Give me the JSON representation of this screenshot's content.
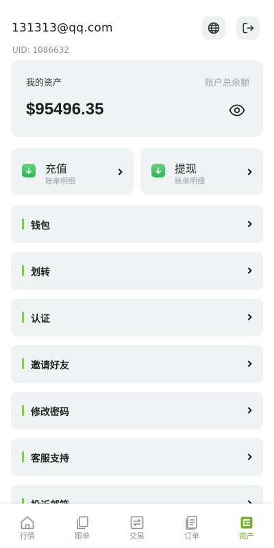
{
  "user": {
    "email": "131313@qq.com",
    "uid": "UID: 1086632"
  },
  "header": {
    "globe_icon": "globe-icon",
    "logout_icon": "logout-icon"
  },
  "asset": {
    "title": "我的资产",
    "subtitle": "账户总余额",
    "amount": "$95496.35",
    "visibility_icon": "eye-icon"
  },
  "quick_actions": [
    {
      "title": "充值",
      "sub": "账单明细",
      "icon": "download-arrow-icon"
    },
    {
      "title": "提现",
      "sub": "账单明细",
      "icon": "download-arrow-icon"
    }
  ],
  "menu": [
    {
      "label": "钱包"
    },
    {
      "label": "划转"
    },
    {
      "label": "认证"
    },
    {
      "label": "邀请好友"
    },
    {
      "label": "修改密码"
    },
    {
      "label": "客服支持"
    },
    {
      "label": "投诉邮箱"
    }
  ],
  "tabs": [
    {
      "label": "行情",
      "icon": "home-icon",
      "active": false
    },
    {
      "label": "跟单",
      "icon": "copy-icon",
      "active": false
    },
    {
      "label": "交易",
      "icon": "exchange-icon",
      "active": false
    },
    {
      "label": "订单",
      "icon": "document-icon",
      "active": false
    },
    {
      "label": "资产",
      "icon": "wallet-icon",
      "active": true
    }
  ],
  "colors": {
    "accent": "#7bcf4a",
    "card_bg": "#f0f3f4",
    "active_tab": "#6fb51f"
  }
}
